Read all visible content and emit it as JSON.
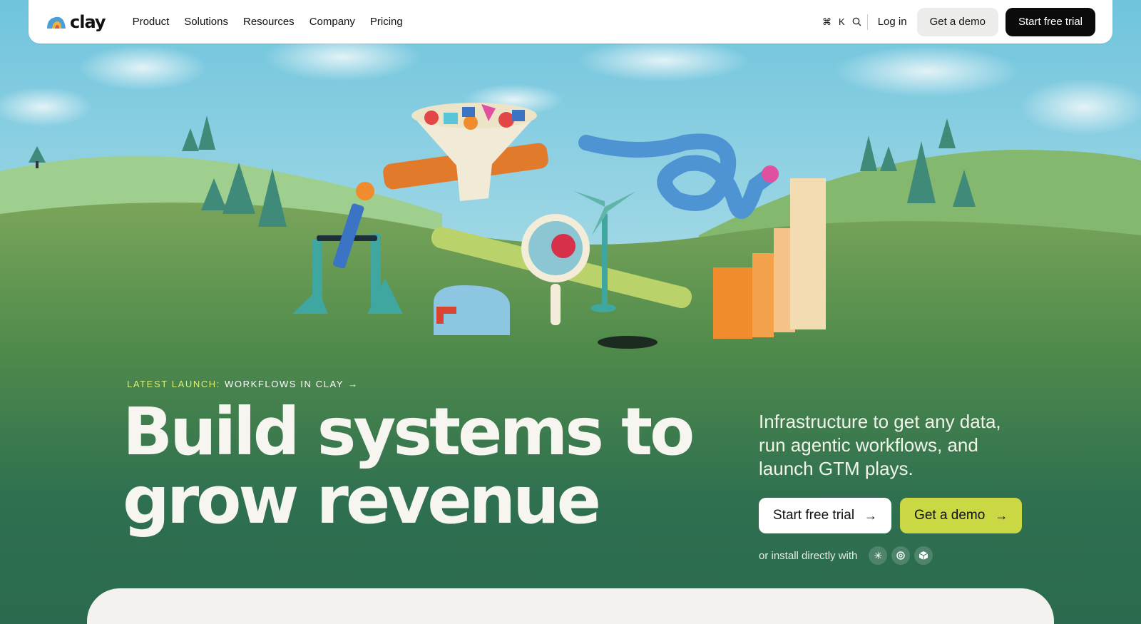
{
  "brand": {
    "name": "clay"
  },
  "nav": {
    "menu": [
      {
        "label": "Product"
      },
      {
        "label": "Solutions"
      },
      {
        "label": "Resources"
      },
      {
        "label": "Company"
      },
      {
        "label": "Pricing"
      }
    ],
    "shortcut": {
      "cmd": "⌘",
      "key": "K",
      "icon": "search-icon"
    },
    "login_label": "Log in",
    "demo_label": "Get a demo",
    "trial_label": "Start free trial"
  },
  "hero": {
    "launch_label": "LATEST LAUNCH:",
    "launch_title": "WORKFLOWS IN CLAY",
    "headline_line1": "Build systems to",
    "headline_line2": "grow revenue",
    "subtext": "Infrastructure to get any data, run agentic workflows, and launch GTM plays.",
    "cta_trial": "Start free trial",
    "cta_demo": "Get a demo",
    "install_text": "or install directly with",
    "integrations": [
      {
        "icon": "claude-icon"
      },
      {
        "icon": "openai-icon"
      },
      {
        "icon": "cube-icon"
      }
    ]
  },
  "colors": {
    "grass": "#2b6a4e",
    "accent": "#c9d843",
    "launch_accent": "#d9ef7c",
    "nav_dark": "#0b0b0b"
  }
}
